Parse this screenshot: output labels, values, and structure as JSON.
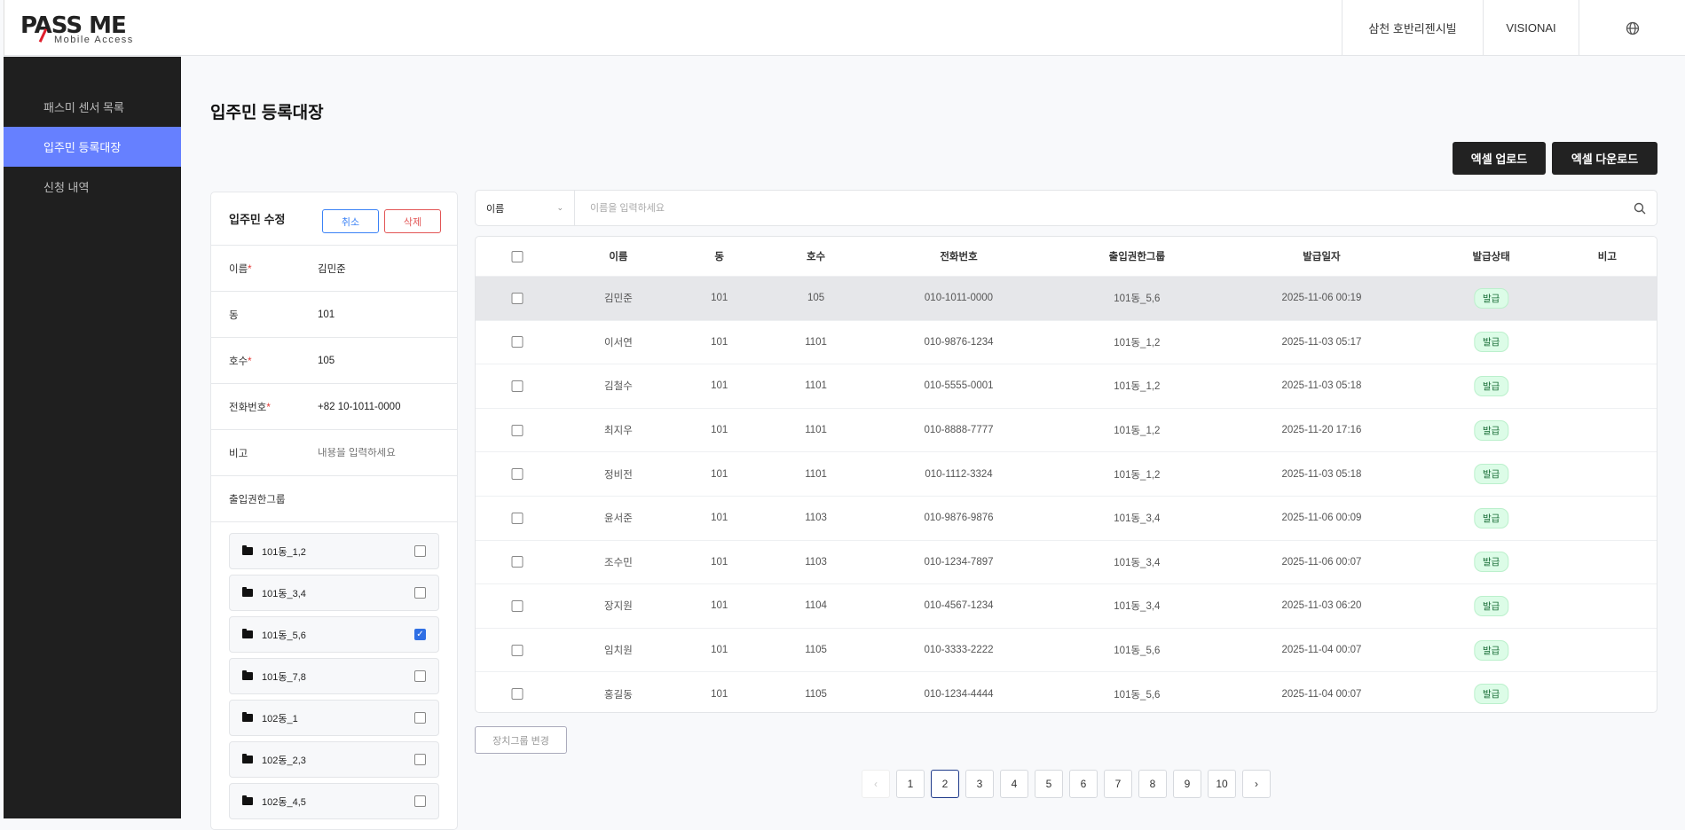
{
  "header": {
    "logo_text": "PASS ME",
    "logo_sub": "Mobile Access",
    "site": "삼천 호반리젠시빌",
    "user": "VISIONAI",
    "globe_icon": "globe-icon"
  },
  "sidebar": {
    "items": [
      {
        "label": "패스미 센서 목록"
      },
      {
        "label": "입주민 등록대장"
      },
      {
        "label": "신청 내역"
      }
    ],
    "active": 1
  },
  "page": {
    "title": "입주민 등록대장",
    "excel_upload": "엑셀 업로드",
    "excel_download": "엑셀 다운로드"
  },
  "edit": {
    "title": "입주민 수정",
    "cancel": "취소",
    "delete": "삭제",
    "fields": [
      {
        "label": "이름",
        "required": "*",
        "value": "김민준"
      },
      {
        "label": "동",
        "required": "",
        "value": "101"
      },
      {
        "label": "호수",
        "required": "*",
        "value": "105"
      },
      {
        "label": "전화번호",
        "required": "*",
        "value": "+82 10-1011-0000"
      }
    ],
    "memo_label": "비고",
    "memo_placeholder": "내용을 입력하세요",
    "group_label": "출입권한그룹",
    "groups": [
      {
        "name": "101동_1,2",
        "checked": false
      },
      {
        "name": "101동_3,4",
        "checked": false
      },
      {
        "name": "101동_5,6",
        "checked": true
      },
      {
        "name": "101동_7,8",
        "checked": false
      },
      {
        "name": "102동_1",
        "checked": false
      },
      {
        "name": "102동_2,3",
        "checked": false
      },
      {
        "name": "102동_4,5",
        "checked": false
      }
    ]
  },
  "search": {
    "field": "이름",
    "placeholder": "이름을 입력하세요"
  },
  "table": {
    "columns": [
      "이름",
      "동",
      "호수",
      "전화번호",
      "출입권한그룹",
      "발급일자",
      "발급상태",
      "비고"
    ],
    "rows": [
      [
        "김민준",
        "101",
        "105",
        "010-1011-0000",
        "101동_5,6",
        "2025-11-06 00:19",
        "발급",
        ""
      ],
      [
        "이서연",
        "101",
        "1101",
        "010-9876-1234",
        "101동_1,2",
        "2025-11-03 05:17",
        "발급",
        ""
      ],
      [
        "김철수",
        "101",
        "1101",
        "010-5555-0001",
        "101동_1,2",
        "2025-11-03 05:18",
        "발급",
        ""
      ],
      [
        "최지우",
        "101",
        "1101",
        "010-8888-7777",
        "101동_1,2",
        "2025-11-20 17:16",
        "발급",
        ""
      ],
      [
        "정비전",
        "101",
        "1101",
        "010-1112-3324",
        "101동_1,2",
        "2025-11-03 05:18",
        "발급",
        ""
      ],
      [
        "윤서준",
        "101",
        "1103",
        "010-9876-9876",
        "101동_3,4",
        "2025-11-06 00:09",
        "발급",
        ""
      ],
      [
        "조수민",
        "101",
        "1103",
        "010-1234-7897",
        "101동_3,4",
        "2025-11-06 00:07",
        "발급",
        ""
      ],
      [
        "장지원",
        "101",
        "1104",
        "010-4567-1234",
        "101동_3,4",
        "2025-11-03 06:20",
        "발급",
        ""
      ],
      [
        "임치원",
        "101",
        "1105",
        "010-3333-2222",
        "101동_5,6",
        "2025-11-04 00:07",
        "발급",
        ""
      ],
      [
        "홍길동",
        "101",
        "1105",
        "010-1234-4444",
        "101동_5,6",
        "2025-11-04 00:07",
        "발급",
        ""
      ]
    ],
    "selected_row": 0
  },
  "change_group": "장치그룹 변경",
  "pagination": {
    "prev": "‹",
    "next": "›",
    "pages": [
      "1",
      "2",
      "3",
      "4",
      "5",
      "6",
      "7",
      "8",
      "9",
      "10"
    ],
    "current": "2"
  }
}
